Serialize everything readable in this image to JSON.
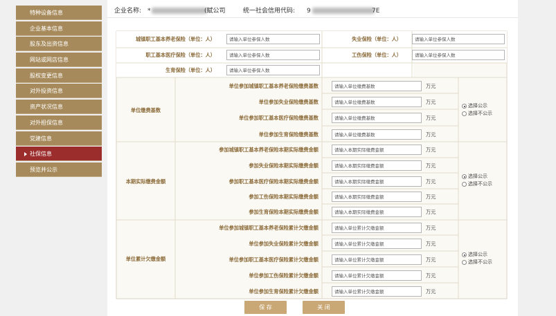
{
  "sidebar": {
    "items": [
      {
        "label": "特种设备信息"
      },
      {
        "label": "企业基本信息"
      },
      {
        "label": "股东及出资信息"
      },
      {
        "label": "网站或网店信息"
      },
      {
        "label": "股权变更信息"
      },
      {
        "label": "对外投资信息"
      },
      {
        "label": "资产状况信息"
      },
      {
        "label": "对外担保信息"
      },
      {
        "label": "党建信息"
      },
      {
        "label": "社保信息",
        "active": true
      },
      {
        "label": "预览并公示"
      }
    ]
  },
  "company": {
    "name_label": "企业名称:",
    "name_partial": "*",
    "name_suffix": "(赋公司",
    "credit_label": "统一社会信用代码:",
    "credit_partial": "9",
    "credit_suffix": "7E"
  },
  "insured": [
    {
      "label": "城镇职工基本养老保险（单位：人）",
      "placeholder": "请输入单位参保人数"
    },
    {
      "label": "失业保险（单位：人）",
      "placeholder": "请输入单位参保人数"
    },
    {
      "label": "职工基本医疗保险（单位：人）",
      "placeholder": "请输入单位参保人数"
    },
    {
      "label": "工伤保险（单位：人）",
      "placeholder": "请输入单位参保人数"
    },
    {
      "label": "生育保险（单位：人）",
      "placeholder": "请输入单位参保人数"
    }
  ],
  "sections": [
    {
      "title": "单位缴费基数",
      "rows": [
        {
          "label": "单位参加城镇职工基本养老保险缴费基数",
          "placeholder": "请输入单位缴费基数",
          "unit": "万元"
        },
        {
          "label": "单位参加失业保险缴费基数",
          "placeholder": "请输入单位缴费基数",
          "unit": "万元"
        },
        {
          "label": "单位参加职工基本医疗保险缴费基数",
          "placeholder": "请输入单位缴费基数",
          "unit": "万元"
        },
        {
          "label": "单位参加生育保险缴费基数",
          "placeholder": "请输入单位缴费基数",
          "unit": "万元"
        }
      ],
      "radios": [
        {
          "label": "选择公示",
          "checked": true
        },
        {
          "label": "选择不公示",
          "checked": false
        }
      ]
    },
    {
      "title": "本期实际缴费金额",
      "rows": [
        {
          "label": "参加城镇职工基本养老保险本期实际缴费金额",
          "placeholder": "请输入本期实际缴费金额",
          "unit": "万元"
        },
        {
          "label": "参加失业保险本期实际缴费金额",
          "placeholder": "请输入本期实际缴费金额",
          "unit": "万元"
        },
        {
          "label": "参加职工基本医疗保险本期实际缴费金额",
          "placeholder": "请输入本期实际缴费金额",
          "unit": "万元"
        },
        {
          "label": "参加工伤保险本期实际缴费金额",
          "placeholder": "请输入本期实际缴费金额",
          "unit": "万元"
        },
        {
          "label": "参加生育保险本期实际缴费金额",
          "placeholder": "请输入本期实际缴费金额",
          "unit": "万元"
        }
      ],
      "radios": [
        {
          "label": "选择公示",
          "checked": true
        },
        {
          "label": "选择不公示",
          "checked": false
        }
      ]
    },
    {
      "title": "单位累计欠缴金额",
      "rows": [
        {
          "label": "单位参加城镇职工基本养老保险累计欠缴金额",
          "placeholder": "请输入单位累计欠缴金额",
          "unit": "万元"
        },
        {
          "label": "单位参加失业保险累计欠缴金额",
          "placeholder": "请输入单位累计欠缴金额",
          "unit": "万元"
        },
        {
          "label": "单位参加职工基本医疗保险累计欠缴金额",
          "placeholder": "请输入单位累计欠缴金额",
          "unit": "万元"
        },
        {
          "label": "单位参加工伤保险累计欠缴金额",
          "placeholder": "请输入单位累计欠缴金额",
          "unit": "万元"
        },
        {
          "label": "单位参加生育保险累计欠缴金额",
          "placeholder": "请输入单位累计欠缴金额",
          "unit": "万元"
        }
      ],
      "radios": [
        {
          "label": "选择公示",
          "checked": true
        },
        {
          "label": "选择不公示",
          "checked": false
        }
      ]
    }
  ],
  "buttons": {
    "save": "保 存",
    "close": "关 闭"
  },
  "colors": {
    "nav": "#a68a5b",
    "nav_active": "#9b2d2d",
    "label": "#8b6b3a",
    "button": "#c9a876",
    "cell_bg": "#fbf9f3"
  }
}
